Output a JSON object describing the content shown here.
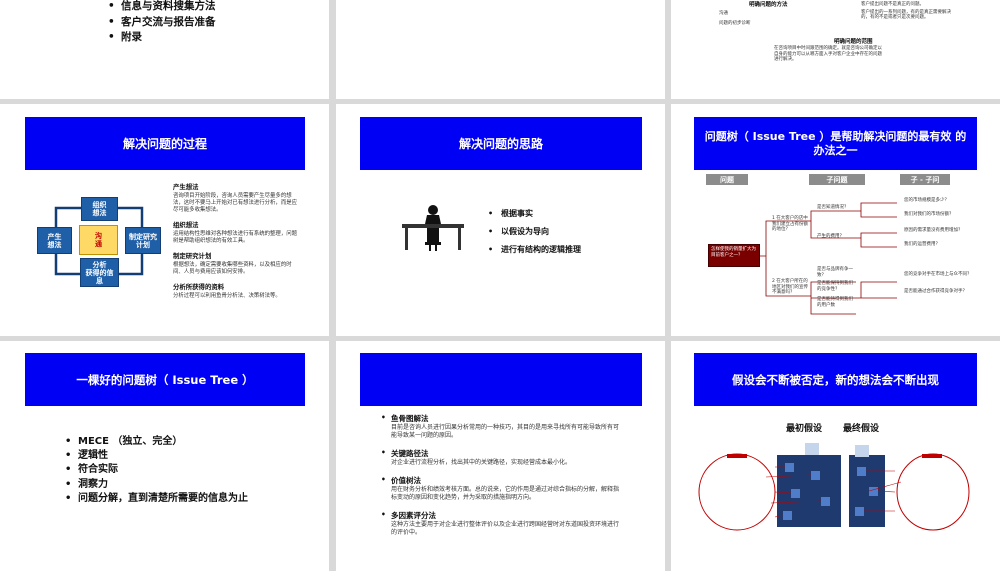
{
  "s1": {
    "items": [
      "信息与资料搜集方法",
      "客户交流与报告准备",
      "附录"
    ]
  },
  "s3": {
    "h1": "明确问题的方法",
    "left": [
      "沟通",
      "问题的初步诊断"
    ],
    "right": [
      "客户提出问题不是真正的问题。",
      "客户提出的一系列问题，有的是真正需要解决的，有的不是或者只是次要问题。"
    ],
    "h2": "明确问题的范围",
    "para": "在咨询项目中时间跟范围的确定。就是咨询公司确定以自身的能力可以从哪方面入手对客户企业中存在的问题进行解决。"
  },
  "s4": {
    "title": "解决问题的过程",
    "boxes": {
      "top": "组织\n想法",
      "left": "产生\n想法",
      "center": "沟\n通",
      "right": "制定研究\n计划",
      "bottom": "分析\n获得的信\n息"
    },
    "sections": [
      {
        "h": "产生想法",
        "p": "咨询项目开始阶段，咨询人员需要产生尽量多的想法，这时不要马上开始对已有想法进行分析，而是应尽可能多收集想法。"
      },
      {
        "h": "组织想法",
        "p": "运用结构性思维对各种想法进行有系统的整理，问题树是帮助组织想法的有效工具。"
      },
      {
        "h": "制定研究计划",
        "p": "根据想法，确定需要收集哪些资料，以及相应的时间、人员与费用应该如何安排。"
      },
      {
        "h": "分析所获得的资料",
        "p": "分析过程可以利用鱼骨分析法、决策树法等。"
      }
    ]
  },
  "s5": {
    "title": "解决问题的思路",
    "items": [
      "根据事实",
      "以假设为导向",
      "进行有结构的逻辑推理"
    ]
  },
  "s6": {
    "title": "问题树（ Issue Tree ）是帮助解决问题的最有效 的办法之一",
    "headers": [
      "问题",
      "子问题",
      "子 - 子问",
      "子 - 子问"
    ],
    "root": "怎样使我的销量扩大为目前客户之一？",
    "sub": [
      "1 在大客户的店中我们建立占有份额的地位？",
      "2 在大客户所在的地区对我们的宣传不满意吗？"
    ],
    "subsub": [
      "是否知道情况？",
      "产生的费用？",
      "是否与品牌有争一致？",
      "是否能保持到我们的竞争性？",
      "是否能持得到我们的用户数"
    ],
    "leaves": [
      "您的市场规模是多少？",
      "我们对我们的市场份额？",
      "原因的需求量没有费用增加？",
      "我们的运营费用？",
      "您的竞争对手在市场上与众不同？",
      "是否能通过合作获得竞争对手？"
    ]
  },
  "s7": {
    "title": "一棵好的问题树（ Issue Tree ）",
    "items": [
      "MECE （独立、完全）",
      "逻辑性",
      "符合实际",
      "洞察力",
      "问题分解，直到清楚所需要的信息为止"
    ]
  },
  "s8": {
    "sections": [
      {
        "h": "鱼骨图解法",
        "p": "目前是咨询人员进行因果分析常用的一种技巧，其目的是用来寻找所有可能导致所有可能导致某一问题的原因。"
      },
      {
        "h": "关键路径法",
        "p": "对企业进行流程分析，找出其中的关键路径，实现经营成本最小化。"
      },
      {
        "h": "价值树法",
        "p": "用在财务分析和绩效考核方面。总的说来，它的作用是通过对综合指标的分解，解释指标变动的原因和变化趋势，并为采取的措施指明方向。"
      },
      {
        "h": "多因素评分法",
        "p": "这种方法主要用于对企业进行整体评价以及企业进行跨国经营时对东道国投资环境进行的评价中。"
      }
    ]
  },
  "s9": {
    "title": "假设会不断被否定，新的想法会不断出现",
    "labels": [
      "最初假设",
      "最终假设"
    ]
  }
}
